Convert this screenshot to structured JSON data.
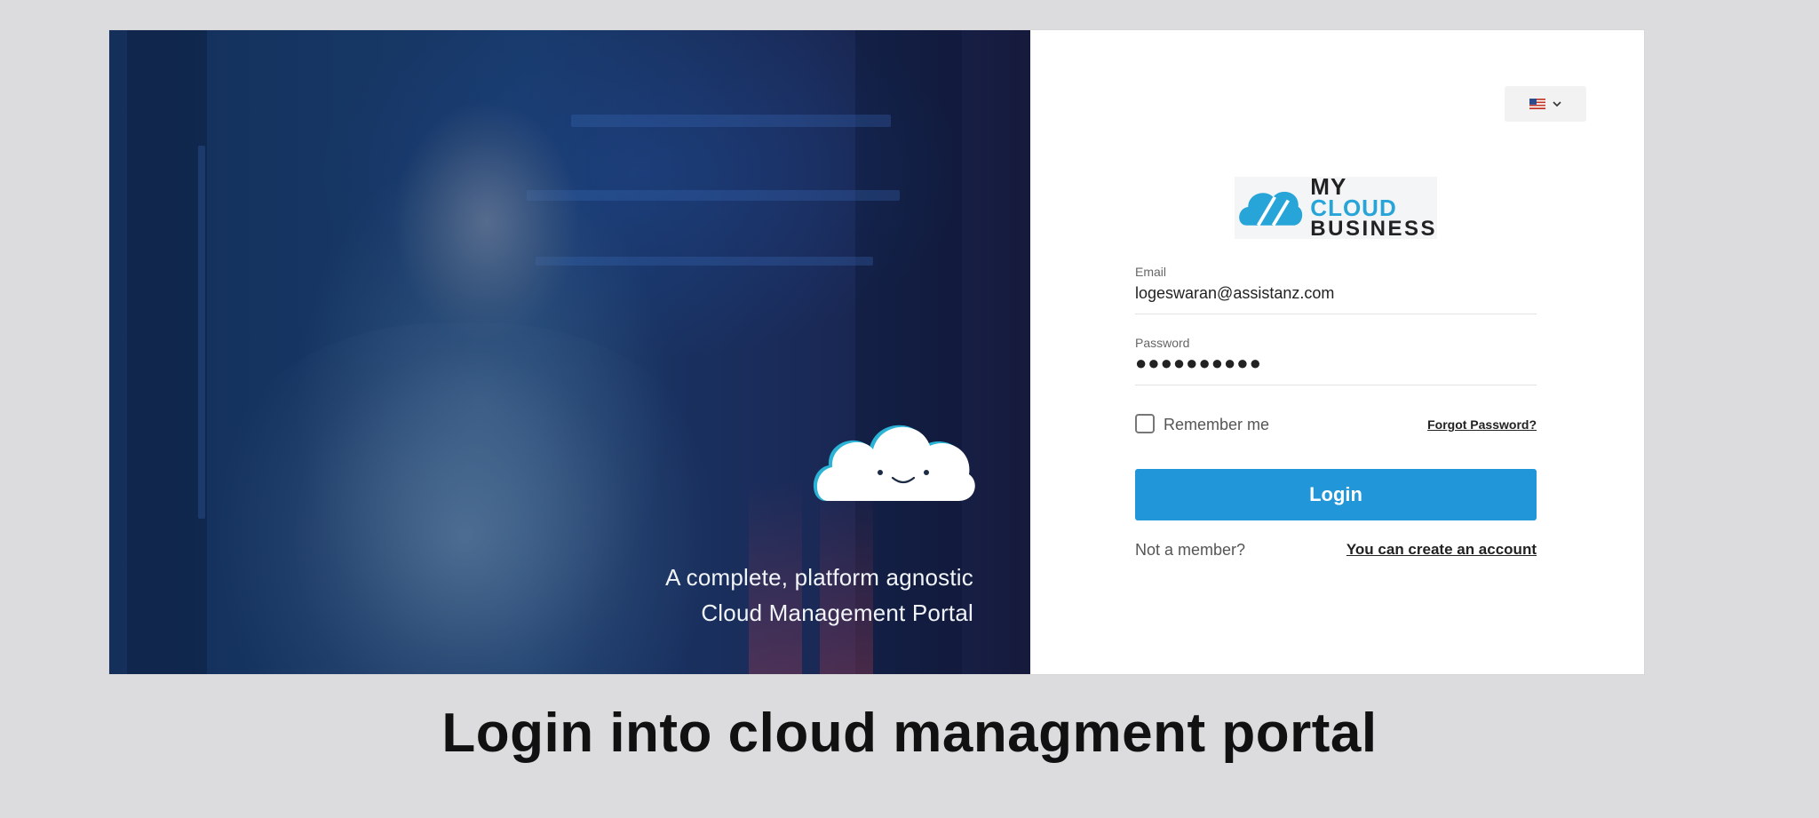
{
  "hero": {
    "tagline_line1": "A complete, platform agnostic",
    "tagline_line2": "Cloud Management Portal",
    "mascot_icon": "smiling-cloud-icon"
  },
  "language": {
    "selected": "US English",
    "flag_icon": "us-flag-icon",
    "toggle_icon": "chevron-down-icon"
  },
  "logo": {
    "word_my": "MY",
    "word_cloud": "CLOUD",
    "word_business": "BUSINESS",
    "icon": "cloud-logo-icon"
  },
  "form": {
    "email_label": "Email",
    "email_value": "logeswaran@assistanz.com",
    "password_label": "Password",
    "password_value": "●●●●●●●●●●",
    "remember_label": "Remember me",
    "remember_checked": false,
    "forgot_label": "Forgot Password?",
    "login_label": "Login",
    "not_member_label": "Not a member?",
    "create_account_label": "You can create an account"
  },
  "caption": "Login into cloud managment portal",
  "colors": {
    "accent": "#2196d9",
    "logo_blue": "#27a4d8",
    "background": "#dcdbdd",
    "hero_dark": "#14305a"
  }
}
